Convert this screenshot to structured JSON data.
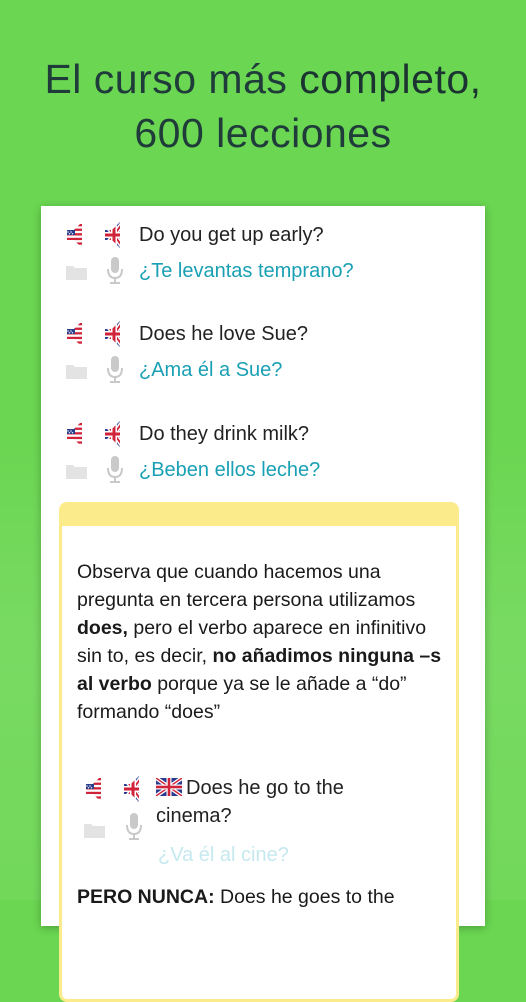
{
  "headline": {
    "line1_prefix": "El curso más ",
    "line1_bold": "completo,",
    "line2": "600 lecciones"
  },
  "phrases": [
    {
      "en": "Do you get up early?",
      "es": "¿Te levantas temprano?"
    },
    {
      "en": "Does he love Sue?",
      "es": "¿Ama él a Sue?"
    },
    {
      "en": "Do they drink milk?",
      "es": "¿Beben ellos leche?"
    }
  ],
  "note": {
    "p1": "Observa que cuando hacemos una pregunta en tercera persona utilizamos ",
    "p1_bold": "does,",
    "p2": " pero el verbo aparece en infinitivo sin to, es decir, ",
    "p2_bold": "no añadimos ninguna –s al verbo",
    "p3": " porque ya se le añade a “do” formando “does”",
    "example_en": "Does he go to the cinema?",
    "example_es": "¿Va él al cine?",
    "footer_bold": "PERO NUNCA:",
    "footer_rest": " Does he goes to the"
  },
  "colors": {
    "background": "#6ad651",
    "spanish_text": "#1aa0b4",
    "note_border": "#fbeb8b"
  },
  "icons": [
    "us-flag-speaker-icon",
    "uk-flag-speaker-icon",
    "folder-icon",
    "microphone-icon"
  ]
}
